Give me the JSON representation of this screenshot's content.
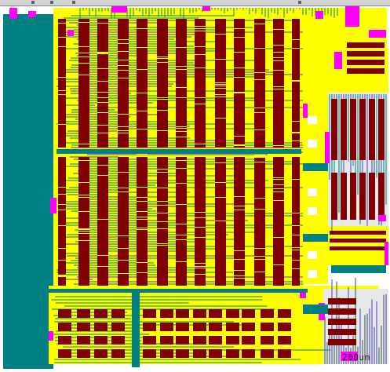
{
  "viewer": {
    "scale_label": "200um"
  },
  "palette": {
    "background": "#ffffff",
    "routing_yellow": "#ffff00",
    "metal_teal": "#008080",
    "cell_maroon": "#800000",
    "via_magenta": "#ff00ff",
    "trace_dark": "#2f4f4f",
    "trace_blue": "#4040c0"
  },
  "layers": [
    {
      "name": "metal-teal"
    },
    {
      "name": "routing-yellow"
    },
    {
      "name": "cell-maroon"
    },
    {
      "name": "via-magenta"
    }
  ]
}
